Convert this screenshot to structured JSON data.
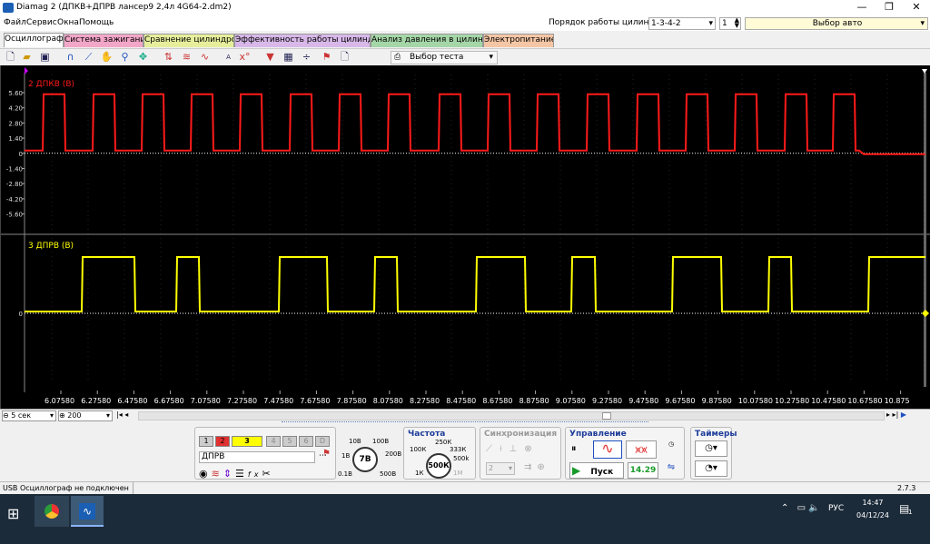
{
  "window": {
    "title": "Diamag 2 (ДПКВ+ДПРВ лансер9 2,4л 4G64-2.dm2)",
    "min_glyph": "—",
    "max_glyph": "❐",
    "close_glyph": "✕"
  },
  "menu": {
    "items": [
      "Файл",
      "Сервис",
      "Окна",
      "Помощь"
    ],
    "firing_order_label": "Порядок работы цилиндров",
    "firing_order_value": "1-3-4-2",
    "cylinder_value": "1",
    "vehicle_select": "Выбор авто"
  },
  "tabs": [
    {
      "label": "Осциллограф",
      "color": "#ffffff"
    },
    {
      "label": "Система зажигания",
      "color": "#f2a6c8"
    },
    {
      "label": "Сравнение цилиндров",
      "color": "#e6ee9c"
    },
    {
      "label": "Эффективность работы цилиндров",
      "color": "#d7b8e8"
    },
    {
      "label": "Анализ давления в цилиндре",
      "color": "#a5d6a7"
    },
    {
      "label": "Электропитание",
      "color": "#f5c6a5"
    }
  ],
  "toolbar": {
    "test_select": "Выбор теста",
    "icons": [
      "new-file-icon",
      "open-folder-icon",
      "save-icon",
      "sine-icon",
      "ramp-icon",
      "hand-icon",
      "zoom-icon",
      "cursor-icon",
      "wave-split-icon",
      "wave-multi-icon",
      "ab-icon",
      "auto-icon",
      "x0-icon",
      "filter-icon",
      "grid-icon",
      "measure-icon",
      "marker-icon",
      "page-icon"
    ]
  },
  "scope": {
    "channel1": {
      "label": "2 ДПКВ (В)",
      "color": "#ff1a1a"
    },
    "channel2": {
      "label": "3 ДПРВ (В)",
      "color": "#ffff00"
    },
    "y_ticks_ch1": [
      "5.60",
      "4.20",
      "2.80",
      "1.40",
      "0",
      "-1.40",
      "-2.80",
      "-4.20",
      "-5.60"
    ],
    "y_ticks_ch2": [
      "0"
    ],
    "x_ticks": [
      "6.07580",
      "6.27580",
      "6.47580",
      "6.67580",
      "7.07580",
      "7.27580",
      "7.47580",
      "7.67580",
      "7.87580",
      "8.07580",
      "8.27580",
      "8.47580",
      "8.67580",
      "8.87580",
      "9.07580",
      "9.27580",
      "9.47580",
      "9.67580",
      "9.87580",
      "10.07580",
      "10.27580",
      "10.47580",
      "10.67580",
      "10.875"
    ]
  },
  "scrollbar": {
    "timebase": "5 сек",
    "points": "200"
  },
  "channels": {
    "buttons": [
      "1",
      "2",
      "3",
      "4",
      "5",
      "6",
      "D"
    ],
    "active": "3",
    "name_field": "ДПРВ",
    "voltage": {
      "value": "7В",
      "labels": [
        "10В",
        "100В",
        "1В",
        "200В",
        "0.1В",
        "500В"
      ]
    }
  },
  "frequency": {
    "title": "Частота",
    "value": "500К",
    "labels": [
      "250К",
      "100К",
      "333К",
      "500k",
      "1К",
      "1М"
    ]
  },
  "sync": {
    "title": "Синхронизация",
    "select": "2"
  },
  "control": {
    "title": "Управление",
    "start_label": "Пуск",
    "counter": "14.29"
  },
  "timers": {
    "title": "Таймеры"
  },
  "status": {
    "left": "USB Осциллограф не подключен",
    "version": "2.7.3"
  },
  "taskbar": {
    "lang": "РУС",
    "time": "14:47",
    "date": "04/12/24",
    "notify_count": "1"
  }
}
